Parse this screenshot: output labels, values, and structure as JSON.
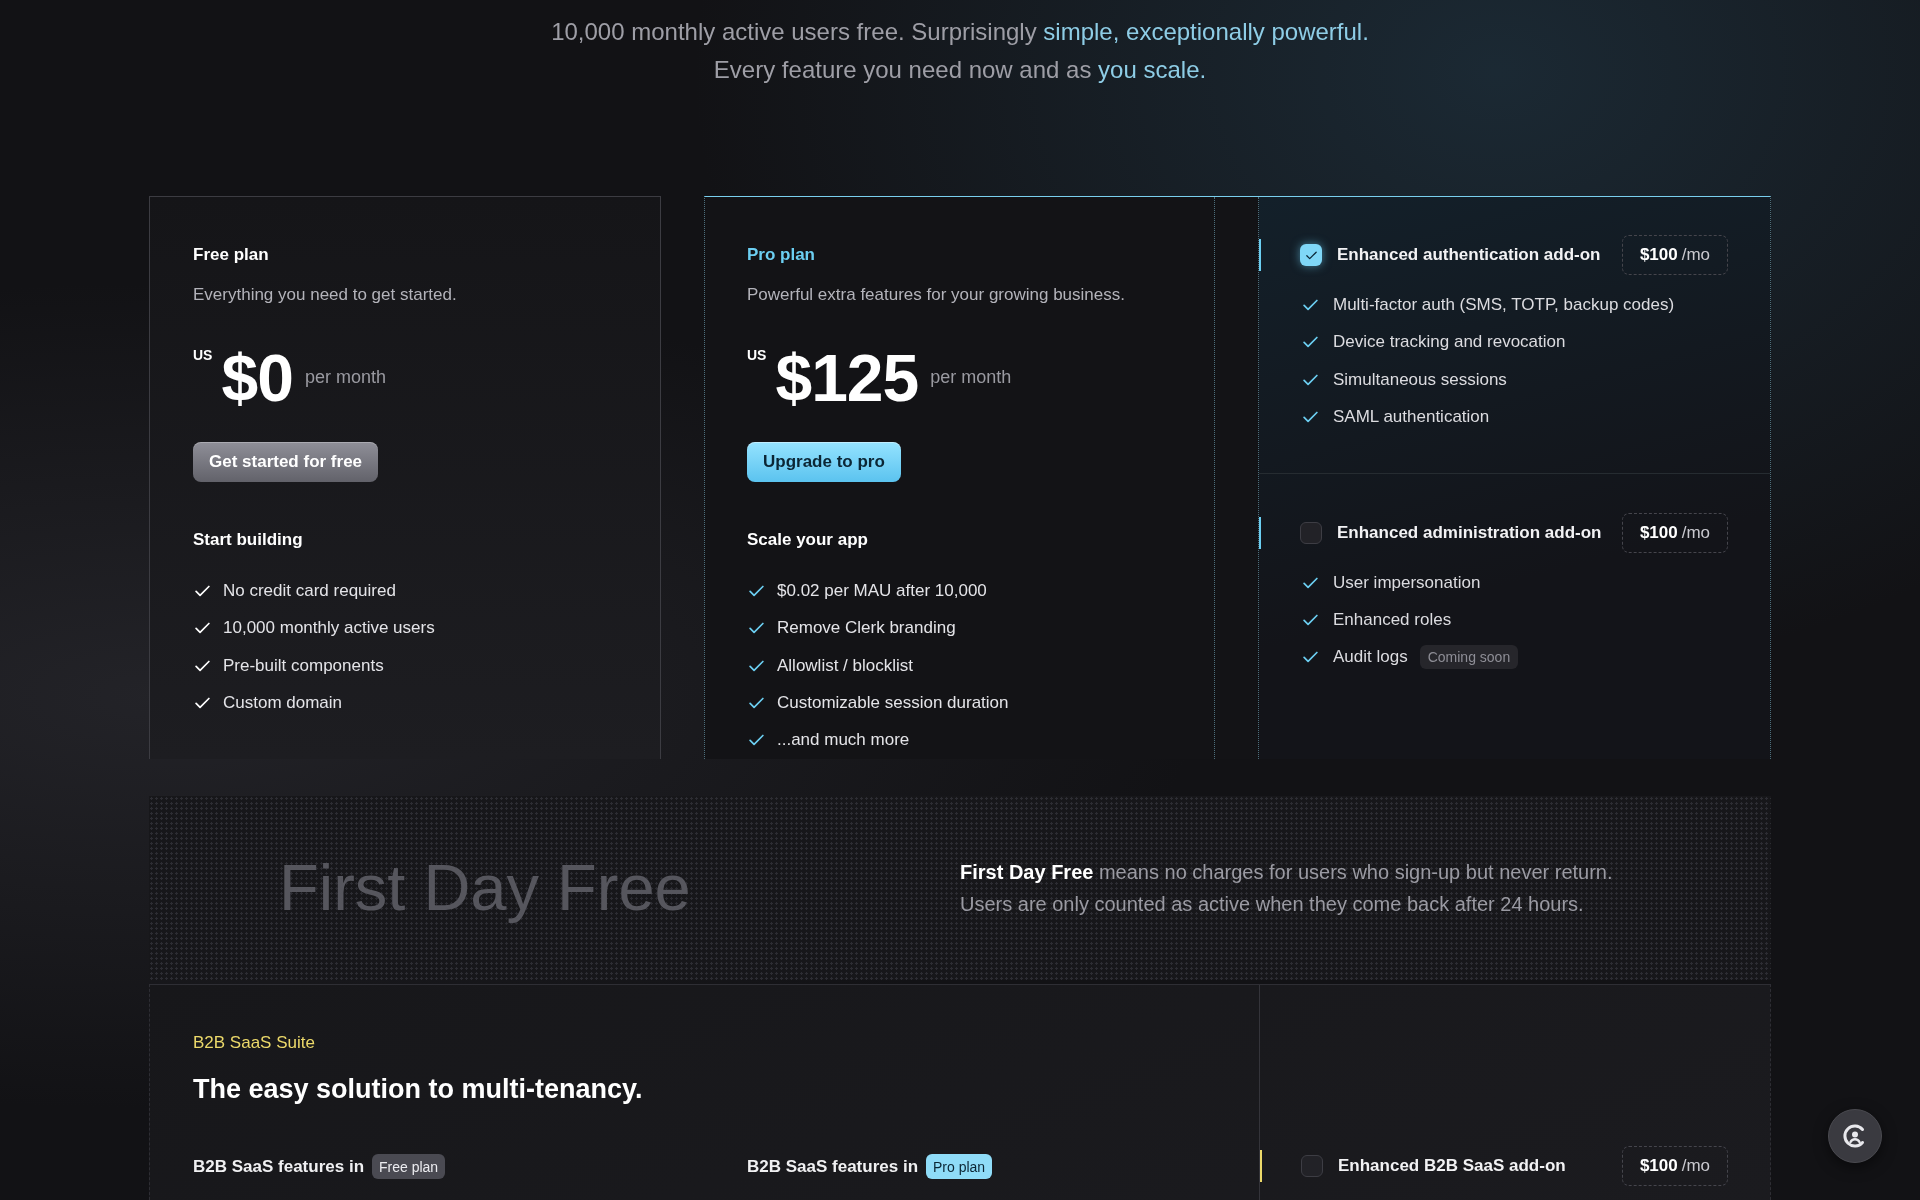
{
  "intro": {
    "lines": [
      [
        {
          "text": "10,000 monthly active users free. Surprisingly ",
          "highlight": false
        },
        {
          "text": "simple, exceptionally powerful.",
          "highlight": true
        }
      ],
      [
        {
          "text": "Every feature you need now and as ",
          "highlight": false
        },
        {
          "text": "you scale.",
          "highlight": true
        }
      ]
    ]
  },
  "plans": [
    {
      "kind": "free",
      "name": "Free plan",
      "description": "Everything you need to get started.",
      "currency": "US",
      "price": "$0",
      "period": "per month",
      "button": "Get started for free",
      "features_heading": "Start building",
      "features": [
        "No credit card required",
        "10,000 monthly active users",
        "Pre-built components",
        "Custom domain"
      ]
    },
    {
      "kind": "pro",
      "name": "Pro plan",
      "description": "Powerful extra features for your growing business.",
      "currency": "US",
      "price": "$125",
      "period": "per month",
      "button": "Upgrade to pro",
      "features_heading": "Scale your app",
      "features": [
        "$0.02 per MAU after 10,000",
        "Remove Clerk branding",
        "Allowlist / blocklist",
        "Customizable session duration",
        "...and much more"
      ]
    }
  ],
  "addons": [
    {
      "name": "Enhanced authentication add-on",
      "checked": true,
      "price": "$100",
      "unit": "/mo",
      "features": [
        {
          "text": "Multi-factor auth (SMS, TOTP, backup codes)"
        },
        {
          "text": "Device tracking and revocation"
        },
        {
          "text": "Simultaneous sessions"
        },
        {
          "text": "SAML authentication"
        }
      ]
    },
    {
      "name": "Enhanced administration add-on",
      "checked": false,
      "price": "$100",
      "unit": "/mo",
      "features": [
        {
          "text": "User impersonation"
        },
        {
          "text": "Enhanced roles"
        },
        {
          "text": "Audit logs",
          "badge": "Coming soon"
        }
      ]
    }
  ],
  "first_day_free": {
    "title": "First Day Free",
    "lines": [
      "**First Day Free** means no charges for users who sign-up but never return.",
      "Users are only counted as active when they come back after 24 hours."
    ]
  },
  "b2b": {
    "eyebrow": "B2B SaaS Suite",
    "heading": "The easy solution to multi-tenancy.",
    "groups": [
      {
        "kind": "free",
        "label": "B2B SaaS features in",
        "badge": "Free plan"
      },
      {
        "kind": "pro",
        "label": "B2B SaaS features in",
        "badge": "Pro plan"
      }
    ],
    "addon": {
      "name": "Enhanced B2B SaaS add-on",
      "checked": false,
      "price": "$100",
      "unit": "/mo"
    }
  }
}
